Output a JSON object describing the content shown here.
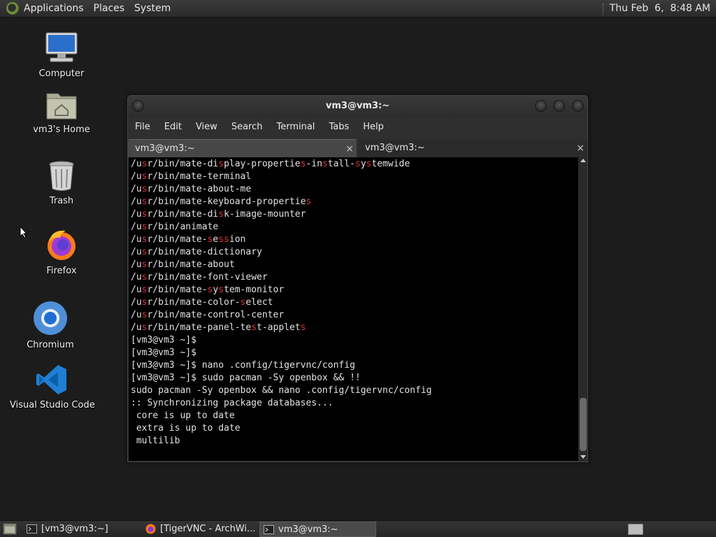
{
  "top_panel": {
    "menus": [
      "Applications",
      "Places",
      "System"
    ],
    "clock": "Thu Feb  6,  8:48 AM"
  },
  "desktop_icons": [
    {
      "label": "Computer",
      "icon": "computer-icon"
    },
    {
      "label": "vm3's Home",
      "icon": "home-folder-icon"
    },
    {
      "label": "Trash",
      "icon": "trash-icon"
    },
    {
      "label": "Firefox",
      "icon": "firefox-icon"
    },
    {
      "label": "Chromium",
      "icon": "chromium-icon"
    },
    {
      "label": "Visual Studio Code",
      "icon": "vscode-icon"
    }
  ],
  "terminal": {
    "title": "vm3@vm3:~",
    "menu": [
      "File",
      "Edit",
      "View",
      "Search",
      "Terminal",
      "Tabs",
      "Help"
    ],
    "tabs": [
      {
        "label": "vm3@vm3:~",
        "close": "×"
      },
      {
        "label": "vm3@vm3:~",
        "close": "×"
      }
    ],
    "lines": [
      "/usr/bin/mate-display-properties-install-systemwide",
      "/usr/bin/mate-terminal",
      "/usr/bin/mate-about-me",
      "/usr/bin/mate-keyboard-properties",
      "/usr/bin/mate-disk-image-mounter",
      "/usr/bin/animate",
      "/usr/bin/mate-session",
      "/usr/bin/mate-dictionary",
      "/usr/bin/mate-about",
      "/usr/bin/mate-font-viewer",
      "/usr/bin/mate-system-monitor",
      "/usr/bin/mate-color-select",
      "/usr/bin/mate-control-center",
      "/usr/bin/mate-panel-test-applets",
      "[vm3@vm3 ~]$",
      "[vm3@vm3 ~]$",
      "[vm3@vm3 ~]$ nano .config/tigervnc/config",
      "[vm3@vm3 ~]$ sudo pacman -Sy openbox && !!",
      "sudo pacman -Sy openbox && nano .config/tigervnc/config",
      ":: Synchronizing package databases...",
      " core is up to date",
      " extra is up to date",
      " multilib"
    ],
    "highlight_color": "#e0303a"
  },
  "taskbar": {
    "tasks": [
      {
        "label": "[vm3@vm3:~]",
        "icon": "terminal-icon",
        "active": false
      },
      {
        "label": "[TigerVNC - ArchWi...",
        "icon": "firefox-icon",
        "active": false
      },
      {
        "label": "vm3@vm3:~",
        "icon": "terminal-icon",
        "active": true
      }
    ]
  }
}
